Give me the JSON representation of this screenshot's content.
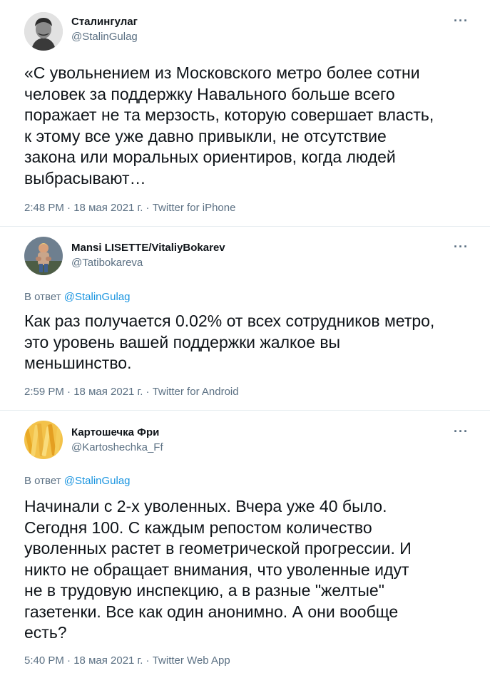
{
  "tweets": [
    {
      "author_name": "Сталингулаг",
      "handle": "@StalinGulag",
      "more": "···",
      "reply_to_prefix": "",
      "reply_to": "",
      "text": "«С увольнением из Московского метро более сотни\nчеловек за поддержку Навального больше всего\nпоражает не та мерзость, которую совершает власть,\nк этому все уже давно привыкли, не отсутствие\nзакона или моральных ориентиров, когда людей\nвыбрасывают…",
      "time": "2:48 PM",
      "date": "18 мая 2021 г.",
      "source": "Twitter for iPhone",
      "avatar_icon": "portrait-photo-icon"
    },
    {
      "author_name": "Mansi LISETTE/VitaliyBokarev",
      "handle": "@Tatibokareva",
      "more": "···",
      "reply_to_prefix": "В ответ",
      "reply_to": "@StalinGulag",
      "text": "Как раз получается 0.02% от всех сотрудников метро,\nэто уровень вашей поддержки жалкое вы\nменьшинство.",
      "time": "2:59 PM",
      "date": "18 мая 2021 г.",
      "source": "Twitter for Android",
      "avatar_icon": "figurine-photo-icon"
    },
    {
      "author_name": "Картошечка Фри",
      "handle": "@Kartoshechka_Ff",
      "more": "···",
      "reply_to_prefix": "В ответ",
      "reply_to": "@StalinGulag",
      "text": "Начинали с 2-х уволенных. Вчера уже 40 было.\nСегодня 100. С каждым репостом количество\nуволенных растет в геометрической прогрессии. И\nникто не обращает внимания, что уволенные идут\nне в трудовую инспекцию, а в разные \"желтые\"\nгазетенки. Все как один анонимно. А они вообще\nесть?",
      "time": "5:40 PM",
      "date": "18 мая 2021 г.",
      "source": "Twitter Web App",
      "avatar_icon": "fries-photo-icon"
    }
  ],
  "separator": " · "
}
